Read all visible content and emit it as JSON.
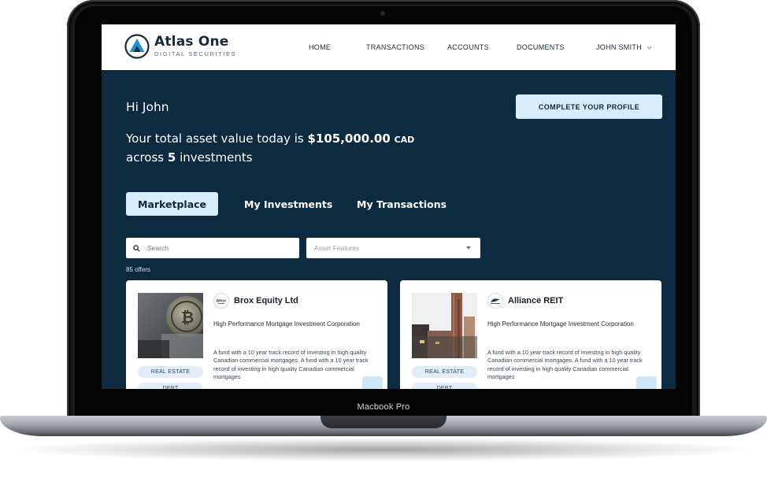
{
  "device": {
    "label": "Macbook Pro"
  },
  "app": {
    "brand_name": "Atlas One",
    "brand_sub": "DIGITAL SECURITIES",
    "logo_icon": "atlas-mountain-logo"
  },
  "nav": {
    "items": [
      "HOME",
      "TRANSACTIONS",
      "ACCOUNTS",
      "DOCUMENTS"
    ],
    "user": "JOHN SMITH"
  },
  "hero": {
    "greeting": "Hi John",
    "total_prefix": "Your total asset value today is ",
    "total_value": "$105,000.00",
    "total_currency": "CAD",
    "total_line2_prefix": "across ",
    "investment_count": "5",
    "total_line2_suffix": " investments",
    "profile_button": "COMPLETE YOUR PROFILE"
  },
  "tabs": [
    {
      "label": "Marketplace",
      "active": true
    },
    {
      "label": "My Investments",
      "active": false
    },
    {
      "label": "My Transactions",
      "active": false
    }
  ],
  "filters": {
    "search_placeholder": "Search",
    "asset_features_placeholder": "Asset Features",
    "offers_count": "85 offers"
  },
  "cards": [
    {
      "title": "Brox Equity Ltd",
      "logo_text": "BROX",
      "subtitle": "High Performance Mortgage Investment Corporation",
      "description": "A fund with a 10 year track record of investing in high quality Canadian commercial mortgages. A fund with a 10 year track record of investing in high quality Canadian commercial mortgages",
      "tags": [
        "REAL ESTATE",
        "DEBT"
      ],
      "image": "crypto-coin-photo"
    },
    {
      "title": "Alliance REIT",
      "logo_text": "ALLIANCE",
      "subtitle": "High Performance Mortgage Investment Corporation",
      "description": "A fund with a 10 year track record of investing in high quality Canadian commercial mortgages. A fund with a 10 year track record of investing in high quality Canadian commercial mortgages",
      "tags": [
        "REAL ESTATE",
        "DEBT"
      ],
      "image": "city-buildings-photo"
    }
  ],
  "colors": {
    "screen_bg": "#0c2a40",
    "accent_light": "#d7edfb",
    "tag_bg": "#e3edf9"
  }
}
